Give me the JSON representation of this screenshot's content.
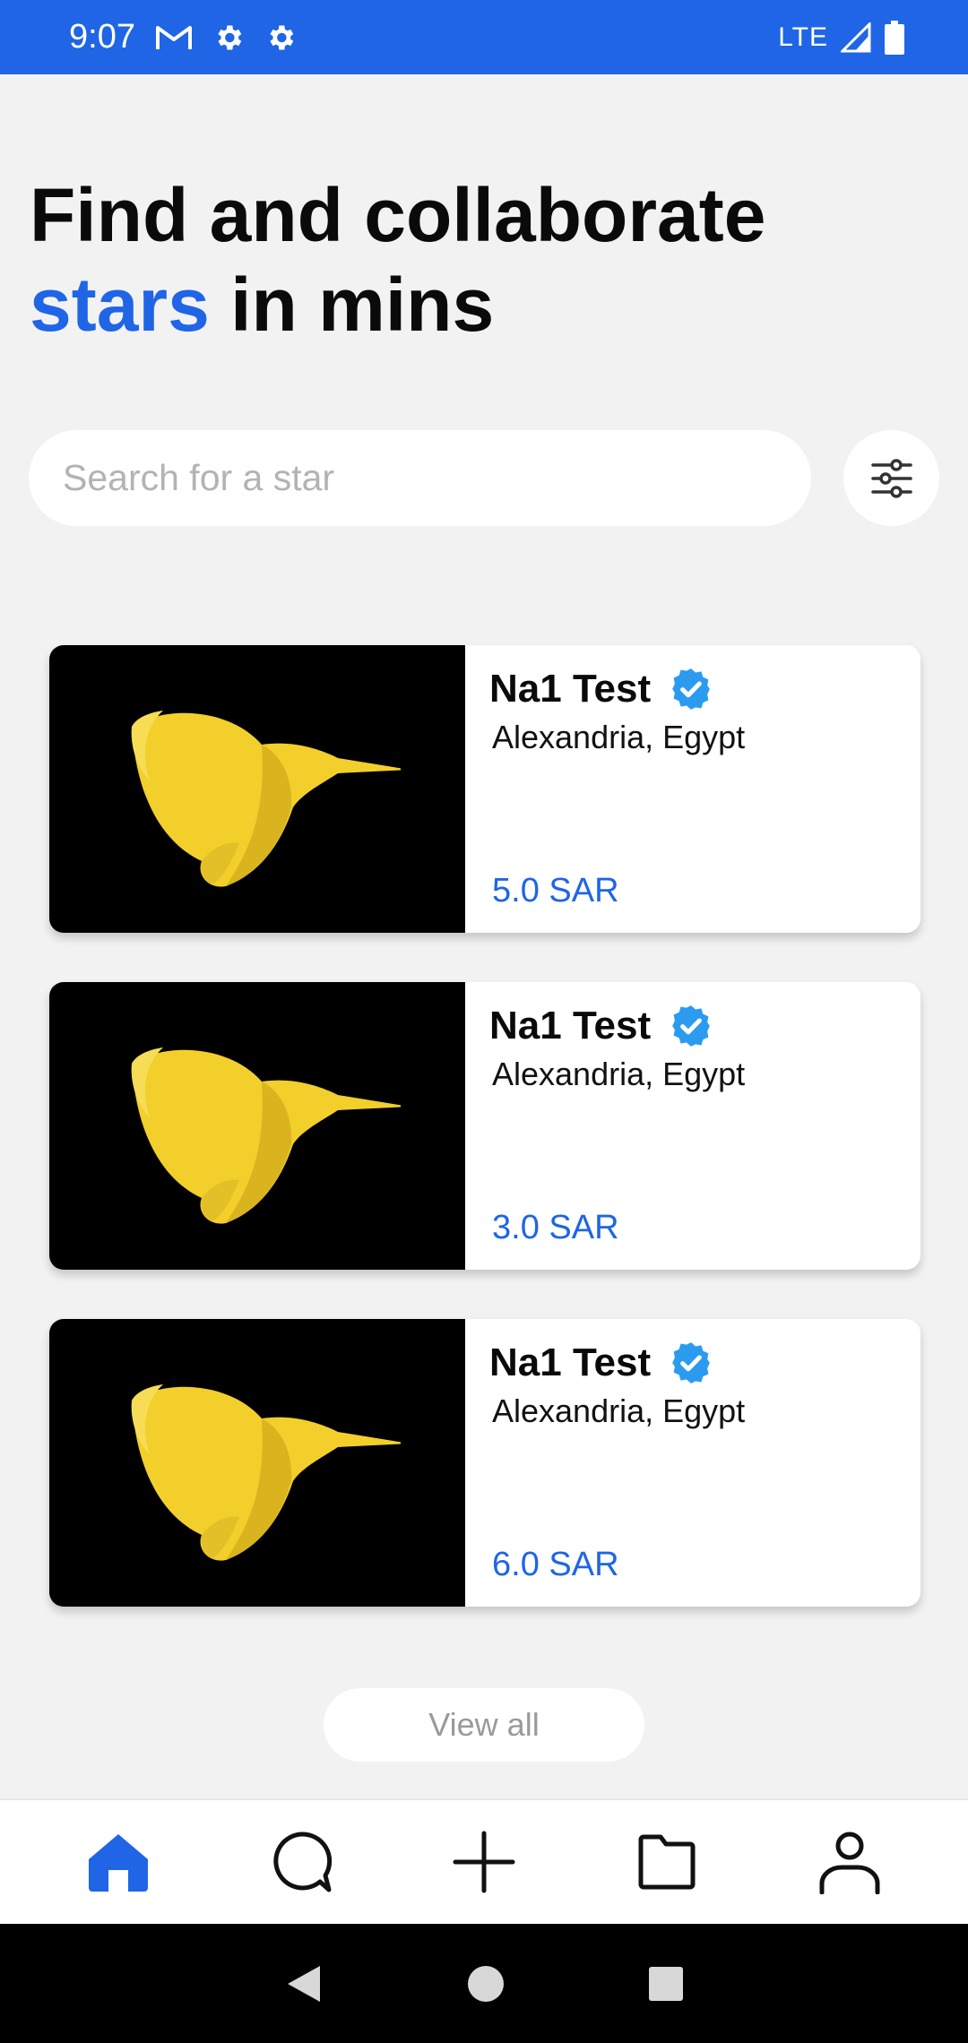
{
  "status_bar": {
    "time": "9:07",
    "network": "LTE",
    "icons": [
      "gmail-icon",
      "settings-icon",
      "settings-icon",
      "signal-icon",
      "battery-icon"
    ]
  },
  "headline": {
    "line1": "Find and collaborate",
    "accent": "stars",
    "line2_rest": " in mins"
  },
  "search": {
    "placeholder": "Search for a star",
    "value": ""
  },
  "cards": [
    {
      "name": "Na1 Test",
      "location": "Alexandria, Egypt",
      "price": "5.0 SAR",
      "verified": true
    },
    {
      "name": "Na1 Test",
      "location": "Alexandria, Egypt",
      "price": "3.0 SAR",
      "verified": true
    },
    {
      "name": "Na1 Test",
      "location": "Alexandria, Egypt",
      "price": "6.0 SAR",
      "verified": true
    }
  ],
  "view_all_label": "View all",
  "bottom_nav": {
    "items": [
      "home-icon",
      "chat-icon",
      "add-icon",
      "folder-icon",
      "profile-icon"
    ],
    "active": "home"
  },
  "colors": {
    "accent": "#1f65e6",
    "verified": "#2b9bf0",
    "bird": "#f2cf2a",
    "background": "#f2f2f2"
  }
}
